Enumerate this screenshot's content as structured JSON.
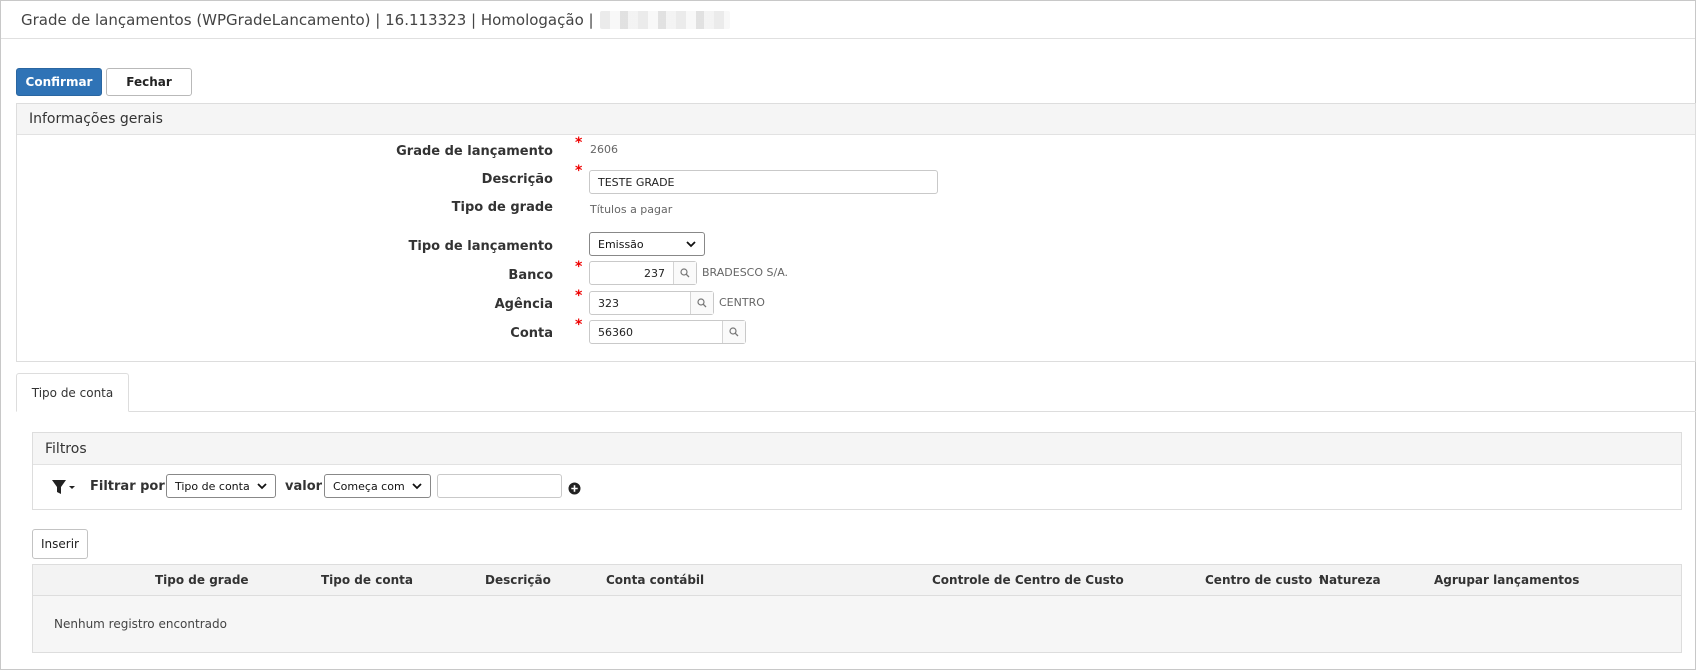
{
  "window": {
    "title": "Grade de lançamentos (WPGradeLancamento) | 16.113323 | Homologação |"
  },
  "toolbar": {
    "confirm_label": "Confirmar",
    "close_label": "Fechar"
  },
  "general_info": {
    "title": "Informações gerais",
    "grade_label": "Grade de lançamento",
    "grade_value": "2606",
    "descricao_label": "Descrição",
    "descricao_value": "TESTE GRADE",
    "tipo_grade_label": "Tipo de grade",
    "tipo_grade_value": "Títulos a pagar",
    "tipo_lancamento_label": "Tipo de lançamento",
    "tipo_lancamento_value": "Emissão",
    "banco_label": "Banco",
    "banco_value": "237",
    "banco_desc": "BRADESCO S/A.",
    "agencia_label": "Agência",
    "agencia_value": "323",
    "agencia_desc": "CENTRO",
    "conta_label": "Conta",
    "conta_value": "56360",
    "required_mark": "*"
  },
  "tabs": [
    {
      "label": "Tipo de conta"
    }
  ],
  "filters": {
    "title": "Filtros",
    "filter_by_label": "Filtrar por",
    "field_value": "Tipo de conta",
    "value_label": "valor",
    "operator_value": "Começa com",
    "search_value": ""
  },
  "grid": {
    "insert_label": "Inserir",
    "columns": [
      "Tipo de grade",
      "Tipo de conta",
      "Descrição",
      "Conta contábil",
      "Controle de Centro de Custo",
      "Centro de custo",
      "Natureza",
      "Agrupar lançamentos"
    ],
    "sort_arrow": "↑",
    "empty_message": "Nenhum registro encontrado"
  },
  "icons": {
    "search": "search-icon",
    "filter": "filter-icon",
    "add": "add-circle-icon",
    "dropdown": "chevron-down-icon"
  },
  "colors": {
    "primary": "#2f73b6",
    "required": "#ee0000"
  }
}
